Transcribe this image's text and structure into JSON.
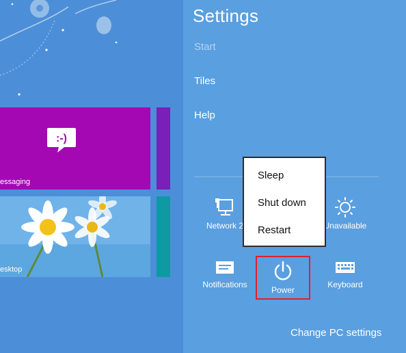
{
  "start_screen": {
    "tiles": [
      {
        "label": "essaging",
        "icon": "smiley-speech-bubble-icon"
      },
      {
        "label": "esktop",
        "icon": "daisy-wallpaper"
      }
    ],
    "smiley_text": ":-)"
  },
  "settings_charm": {
    "title": "Settings",
    "links": [
      "Start",
      "Tiles",
      "Help"
    ],
    "quick_settings": {
      "network_label": "Network",
      "network_partial": "2",
      "unavailable_label": "Unavailable",
      "notifications_label": "Notifications",
      "power_label": "Power",
      "keyboard_label": "Keyboard"
    },
    "change_pc_settings": "Change PC settings"
  },
  "power_menu": {
    "items": [
      "Sleep",
      "Shut down",
      "Restart"
    ]
  },
  "colors": {
    "charm_background": "#5a9fe0",
    "start_background": "#4c8fd8",
    "messaging_tile": "#a408b3",
    "highlight_border": "#e0202a"
  }
}
